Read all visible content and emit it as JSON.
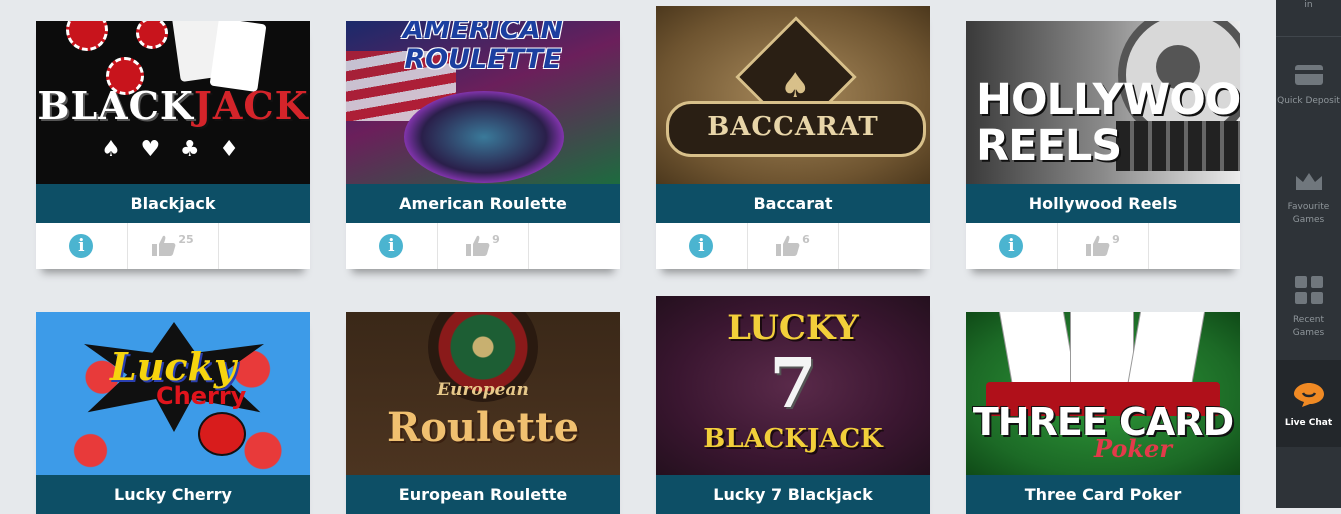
{
  "games": [
    {
      "name": "Blackjack",
      "likes": "25",
      "logo": [
        "BLACK",
        "JACK"
      ],
      "suits": "♠ ♥ ♣ ♦"
    },
    {
      "name": "American Roulette",
      "likes": "9",
      "logo": [
        "AMERICAN",
        "ROULETTE"
      ]
    },
    {
      "name": "Baccarat",
      "likes": "6",
      "logo": [
        "BACCARAT"
      ]
    },
    {
      "name": "Hollywood Reels",
      "likes": "9",
      "logo": [
        "HOLLYWOOD",
        "REELS"
      ]
    },
    {
      "name": "Lucky Cherry",
      "logo": [
        "Lucky",
        "Cherry"
      ]
    },
    {
      "name": "European Roulette",
      "logo": [
        "European",
        "Roulette"
      ]
    },
    {
      "name": "Lucky 7 Blackjack",
      "logo": [
        "LUCKY",
        "7",
        "BLACKJACK"
      ]
    },
    {
      "name": "Three Card Poker",
      "logo": [
        "THREE CARD",
        "Poker"
      ]
    }
  ],
  "sidebar": {
    "top_partial": "in",
    "items": [
      {
        "label": "Quick Deposit",
        "icon": "card-icon"
      },
      {
        "label": "Favourite Games",
        "icon": "crown-icon"
      },
      {
        "label": "Recent Games",
        "icon": "grid-icon"
      },
      {
        "label": "Live Chat",
        "icon": "chat-bubble-icon"
      }
    ]
  },
  "colors": {
    "title_bar": "#0d4f66",
    "info": "#4bb4d0",
    "sidebar": "#2e3338",
    "chat_icon": "#f08a24"
  }
}
